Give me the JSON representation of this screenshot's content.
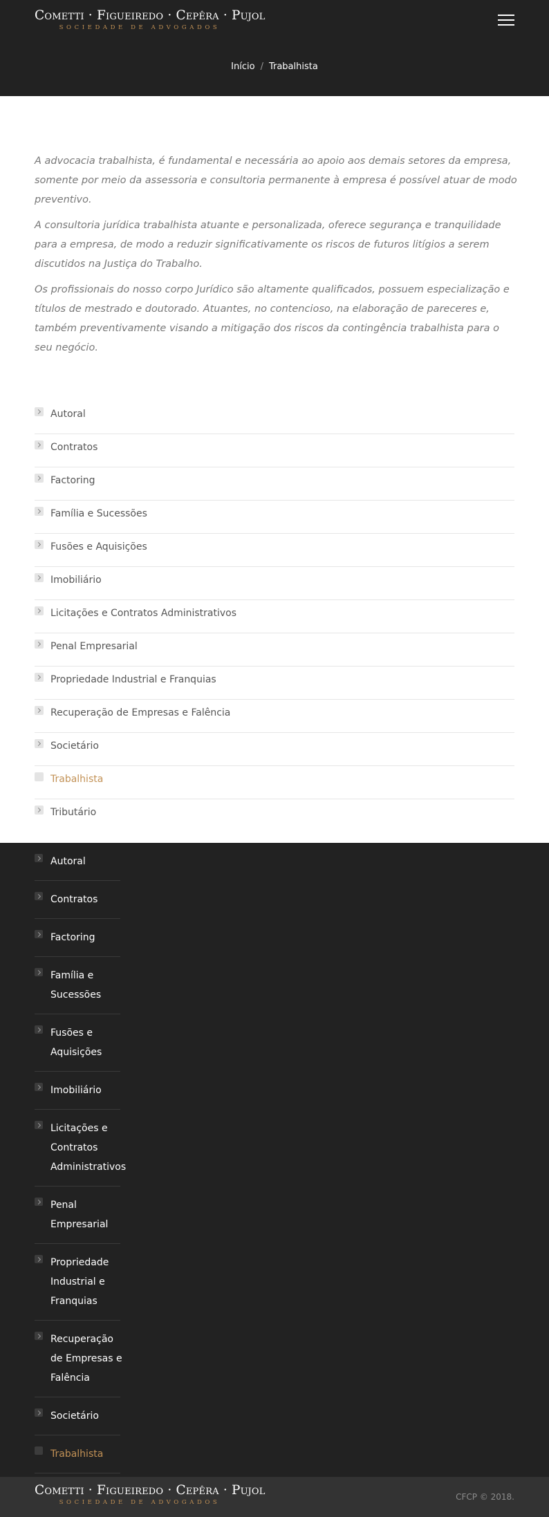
{
  "header": {
    "logo_main": "Cometti · Figueiredo · Cepêra · Pujol",
    "logo_sub": "SOCIEDADE DE ADVOGADOS",
    "menu_icon": "hamburger-menu-icon"
  },
  "breadcrumb": {
    "home": "Início",
    "separator": "/",
    "current": "Trabalhista"
  },
  "intro": {
    "p1": "A advocacia trabalhista, é fundamental e necessária ao apoio aos demais setores da empresa, somente por meio da assessoria e consultoria permanente à empresa é possível atuar de modo preventivo.",
    "p2": "A consultoria jurídica trabalhista atuante e personalizada, oferece segurança e tranquilidade para a empresa, de modo a reduzir significativamente os riscos de futuros litígios a serem discutidos na Justiça do Trabalho.",
    "p3": "Os profissionais do nosso corpo Jurídico são altamente qualificados, possuem especialização e títulos de mestrado e doutorado. Atuantes, no contencioso, na elaboração de pareceres e, também preventivamente visando a mitigação dos riscos da contingência trabalhista para o seu negócio."
  },
  "areas": [
    {
      "label": "Autoral"
    },
    {
      "label": "Contratos"
    },
    {
      "label": "Factoring"
    },
    {
      "label": "Família e Sucessões"
    },
    {
      "label": "Fusões e Aquisições"
    },
    {
      "label": "Imobiliário"
    },
    {
      "label": "Licitações e Contratos Administrativos"
    },
    {
      "label": "Penal Empresarial"
    },
    {
      "label": "Propriedade Industrial e Franquias"
    },
    {
      "label": "Recuperação de Empresas e Falência"
    },
    {
      "label": "Societário"
    },
    {
      "label": "Trabalhista"
    },
    {
      "label": "Tributário"
    }
  ],
  "active_area": "Trabalhista",
  "colors": {
    "accent": "#c29155",
    "dark_bg": "#222222",
    "footer_bg": "#333333"
  },
  "footer": {
    "logo_main": "Cometti · Figueiredo · Cepêra · Pujol",
    "logo_sub": "SOCIEDADE DE ADVOGADOS",
    "copyright": "CFCP © 2018."
  }
}
